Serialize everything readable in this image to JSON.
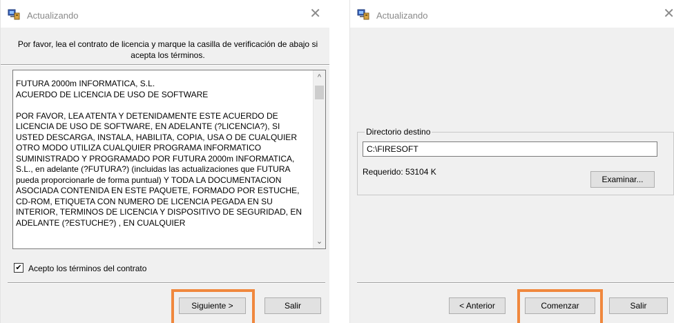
{
  "left_window": {
    "title": "Actualizando",
    "instruction": "Por favor, lea el contrato de licencia y marque la casilla de verificación de abajo si acepta los términos.",
    "license_text": "FUTURA 2000m INFORMATICA, S.L.\nACUERDO DE LICENCIA DE USO DE SOFTWARE\n\nPOR FAVOR, LEA ATENTA Y DETENIDAMENTE ESTE ACUERDO DE LICENCIA DE USO DE SOFTWARE, EN ADELANTE (?LICENCIA?), SI USTED DESCARGA, INSTALA, HABILITA, COPIA, USA O DE CUALQUIER OTRO MODO UTILIZA CUALQUIER PROGRAMA INFORMATICO SUMINISTRADO Y PROGRAMADO POR FUTURA 2000m INFORMATICA, S.L., en adelante (?FUTURA?) (incluidas las actualizaciones que FUTURA pueda proporcionarle de forma puntual) Y TODA LA DOCUMENTACION ASOCIADA CONTENIDA EN ESTE PAQUETE, FORMADO POR ESTUCHE, CD-ROM, ETIQUETA CON NUMERO DE LICENCIA PEGADA EN SU INTERIOR, TERMINOS DE LICENCIA Y DISPOSITIVO DE SEGURIDAD, EN ADELANTE (?ESTUCHE?) , EN CUALQUIER",
    "accept_checked": "✔",
    "accept_label": "Acepto los términos del contrato",
    "next_label": "Siguiente >",
    "exit_label": "Salir"
  },
  "right_window": {
    "title": "Actualizando",
    "group_label": "Directorio destino",
    "directory_value": "C:\\FIRESOFT",
    "required_label": "Requerido: 53104 K",
    "browse_label": "Examinar...",
    "back_label": "< Anterior",
    "start_label": "Comenzar",
    "exit_label": "Salir"
  },
  "colors": {
    "highlight": "#f0883e",
    "dialog_bg": "#f0f0f0"
  },
  "icons": {
    "app": "installer-computer-icon",
    "close": "close-icon",
    "scroll_up": "chevron-up-icon",
    "scroll_down": "chevron-down-icon"
  }
}
